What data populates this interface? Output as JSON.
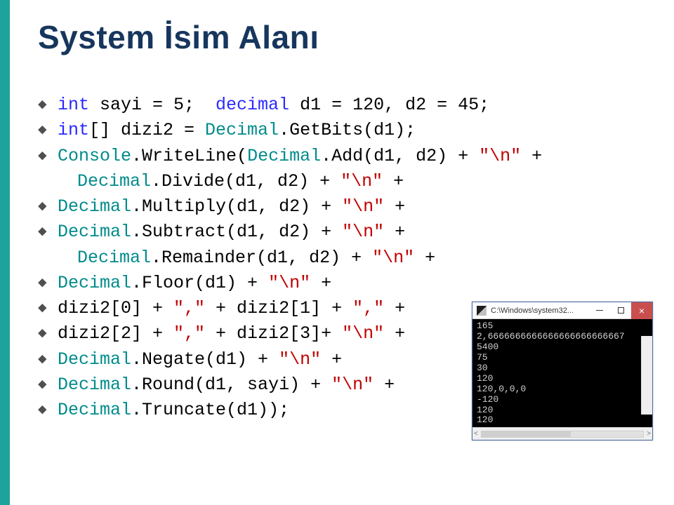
{
  "title": "System İsim Alanı",
  "code": {
    "l1_a": "int",
    "l1_b": " sayi = 5;  ",
    "l1_c": "decimal",
    "l1_d": " d1 = 120, d2 = 45;",
    "l2_a": "int",
    "l2_b": "[] dizi2 = ",
    "l2_c": "Decimal",
    "l2_d": ".GetBits(d1);",
    "l3_a": "Console",
    "l3_b": ".WriteLine(",
    "l3_c": "Decimal",
    "l3_d": ".Add(d1, d2) + ",
    "l3_e": "\"\\n\"",
    "l3_f": " +",
    "l4_a": "Decimal",
    "l4_b": ".Divide(d1, d2) + ",
    "l4_c": "\"\\n\"",
    "l4_d": " +",
    "l5_a": "Decimal",
    "l5_b": ".Multiply(d1, d2) + ",
    "l5_c": "\"\\n\"",
    "l5_d": " +",
    "l6_a": "Decimal",
    "l6_b": ".Subtract(d1, d2) + ",
    "l6_c": "\"\\n\"",
    "l6_d": " +",
    "l7_a": "Decimal",
    "l7_b": ".Remainder(d1, d2) + ",
    "l7_c": "\"\\n\"",
    "l7_d": " +",
    "l8_a": "Decimal",
    "l8_b": ".Floor(d1) + ",
    "l8_c": "\"\\n\"",
    "l8_d": " +",
    "l9_a": "dizi2[0] + ",
    "l9_b": "\",\"",
    "l9_c": " + dizi2[1] + ",
    "l9_d": "\",\"",
    "l9_e": " +",
    "l10_a": "dizi2[2] + ",
    "l10_b": "\",\"",
    "l10_c": " + dizi2[3]+ ",
    "l10_d": "\"\\n\"",
    "l10_e": " +",
    "l11_a": "Decimal",
    "l11_b": ".Negate(d1) + ",
    "l11_c": "\"\\n\"",
    "l11_d": " +",
    "l12_a": "Decimal",
    "l12_b": ".Round(d1, sayi) + ",
    "l12_c": "\"\\n\"",
    "l12_d": " +",
    "l13_a": "Decimal",
    "l13_b": ".Truncate(d1));"
  },
  "console": {
    "title": "C:\\Windows\\system32...",
    "lines": [
      "165",
      "2,6666666666666666666666667",
      "5400",
      "75",
      "30",
      "120",
      "120,0,0,0",
      "-120",
      "120",
      "120"
    ],
    "scroll_left": "<",
    "scroll_right": ">"
  }
}
